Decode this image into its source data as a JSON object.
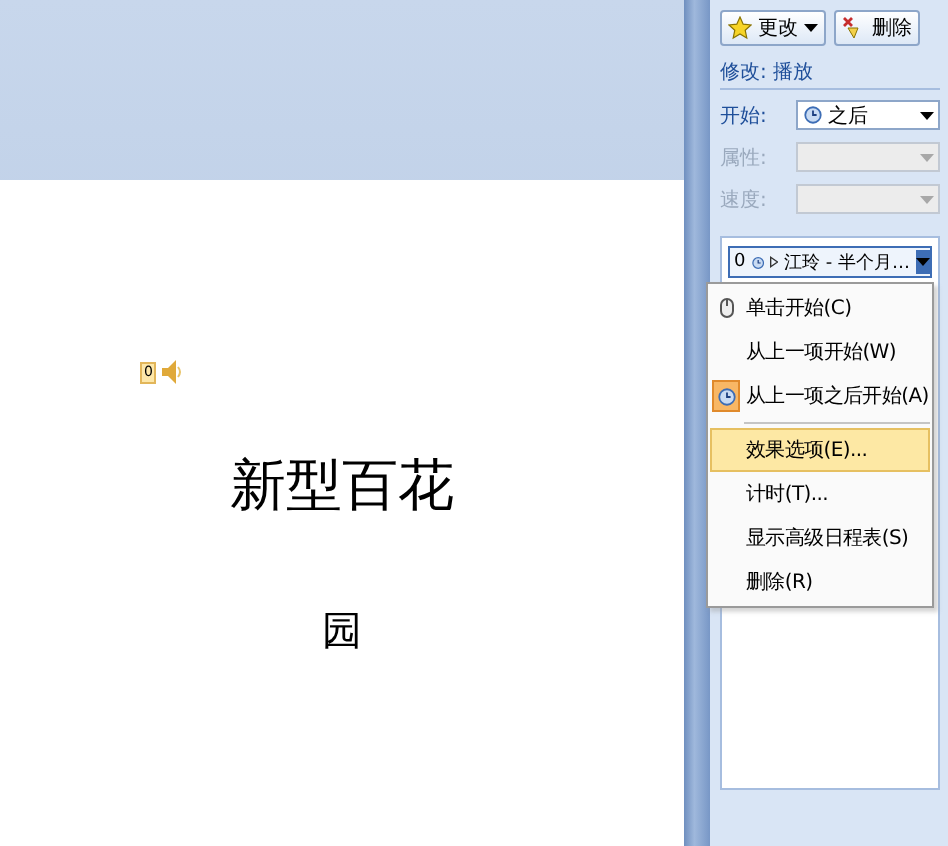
{
  "slide": {
    "sound_marker": "0",
    "title": "新型百花",
    "subtitle": "园"
  },
  "task_pane": {
    "buttons": [
      {
        "label": "更改",
        "kind": "change"
      },
      {
        "label": "删除",
        "kind": "remove"
      }
    ],
    "section_title": "修改: 播放",
    "fields": [
      {
        "label": "开始:",
        "value": "之后",
        "disabled": false
      },
      {
        "label": "属性:",
        "disabled": true
      },
      {
        "label": "速度:",
        "disabled": true
      }
    ],
    "animation_list": [
      {
        "order": "0",
        "name": "江玲 - 半个月…",
        "selected": true
      }
    ],
    "context_menu": [
      [
        {
          "label": "单击开始(C)",
          "kind": "mouse",
          "checked": false,
          "selected": false
        },
        {
          "label": "从上一项开始(W)",
          "kind": "none",
          "checked": false,
          "selected": false
        },
        {
          "label": "从上一项之后开始(A)",
          "kind": "clock",
          "checked": true,
          "selected": false
        }
      ],
      [
        {
          "label": "效果选项(E)...",
          "kind": "none",
          "checked": false,
          "selected": true
        },
        {
          "label": "计时(T)...",
          "kind": "none",
          "checked": false,
          "selected": false
        },
        {
          "label": "显示高级日程表(S)",
          "kind": "none",
          "checked": false,
          "selected": false
        },
        {
          "label": "删除(R)",
          "kind": "none",
          "checked": false,
          "selected": false
        }
      ]
    ]
  }
}
